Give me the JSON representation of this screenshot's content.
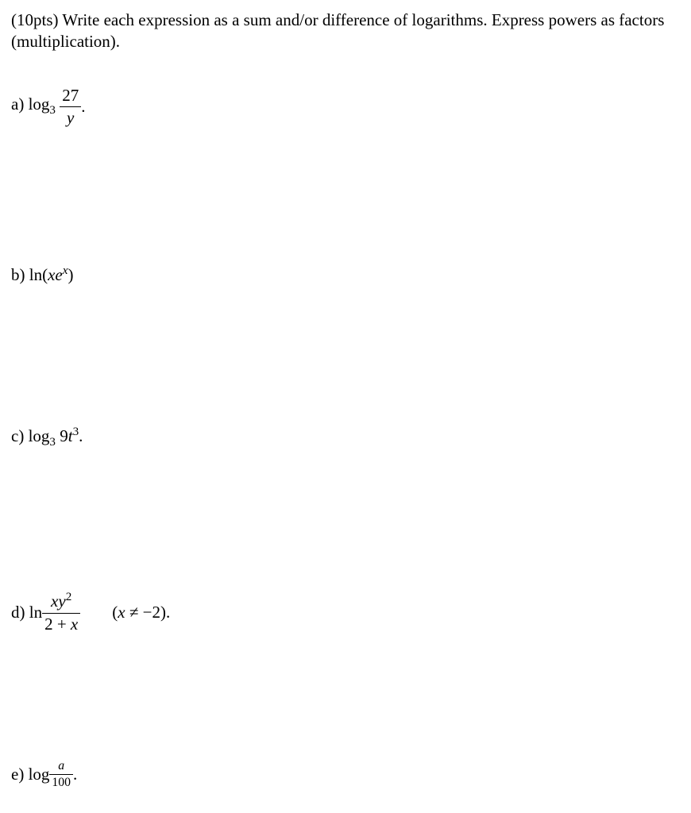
{
  "instructions": {
    "points": "(10pts)",
    "text1": " Write each expression as a sum and/or difference of logarithms.  Express powers as factors (multiplication)."
  },
  "problems": {
    "a": {
      "label": "a) log",
      "sub": "3",
      "frac_num": "27",
      "frac_den_var": "y",
      "period": "."
    },
    "b": {
      "label": "b) ln(",
      "var1": "x",
      "var2": "e",
      "exp": "x",
      "close": ")"
    },
    "c": {
      "label": "c) log",
      "sub": "3",
      "space_num": " 9",
      "var": "t",
      "exp": "3",
      "period": "."
    },
    "d": {
      "label": "d) ln ",
      "num_var1": "x",
      "num_var2": "y",
      "num_exp": "2",
      "den_text": "2 + ",
      "den_var": "x",
      "cond_open": "(",
      "cond_var": "x",
      "cond_rest": " ≠ −2)."
    },
    "e": {
      "label": "e) log ",
      "frac_num_var": "a",
      "frac_den": "100",
      "period": "."
    }
  }
}
